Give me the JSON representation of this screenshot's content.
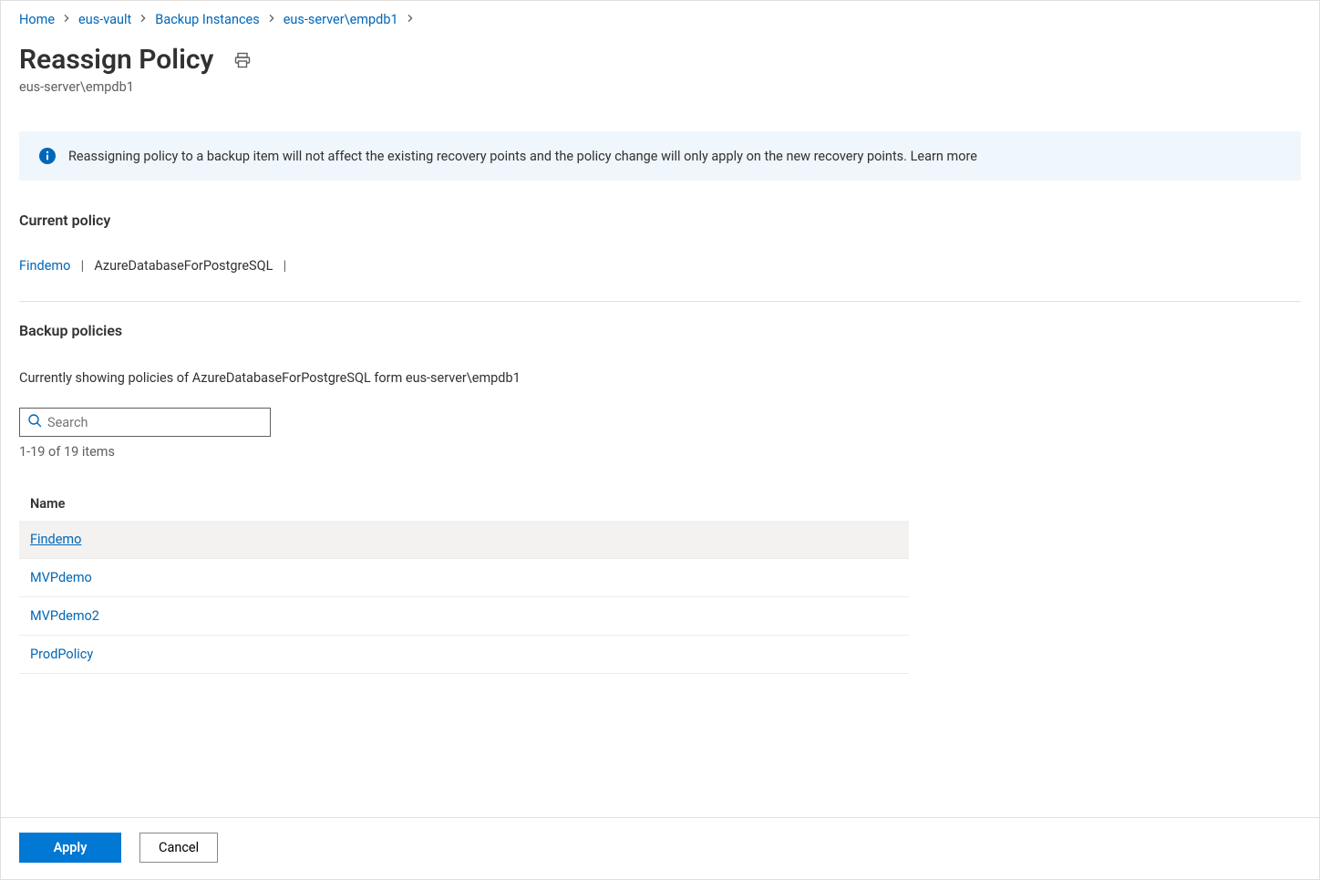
{
  "breadcrumb": {
    "items": [
      {
        "label": "Home"
      },
      {
        "label": "eus-vault"
      },
      {
        "label": "Backup Instances"
      },
      {
        "label": "eus-server\\empdb1"
      }
    ]
  },
  "title": "Reassign Policy",
  "subtitle": "eus-server\\empdb1",
  "infoBanner": {
    "text": "Reassigning policy to a backup item will not affect the existing recovery points and the policy change will only apply on the new recovery points. Learn more"
  },
  "currentPolicy": {
    "heading": "Current policy",
    "nameLabel": "Findemo",
    "typeLabel": "AzureDatabaseForPostgreSQL"
  },
  "backupPolicies": {
    "heading": "Backup policies",
    "description": "Currently showing policies of AzureDatabaseForPostgreSQL form eus-server\\empdb1",
    "search": {
      "placeholder": "Search",
      "value": ""
    },
    "countLabel": "1-19 of 19 items",
    "tableHeader": "Name",
    "rows": [
      {
        "name": "Findemo",
        "selected": true
      },
      {
        "name": "MVPdemo",
        "selected": false
      },
      {
        "name": "MVPdemo2",
        "selected": false
      },
      {
        "name": "ProdPolicy",
        "selected": false
      }
    ]
  },
  "buttons": {
    "apply": "Apply",
    "cancel": "Cancel"
  }
}
